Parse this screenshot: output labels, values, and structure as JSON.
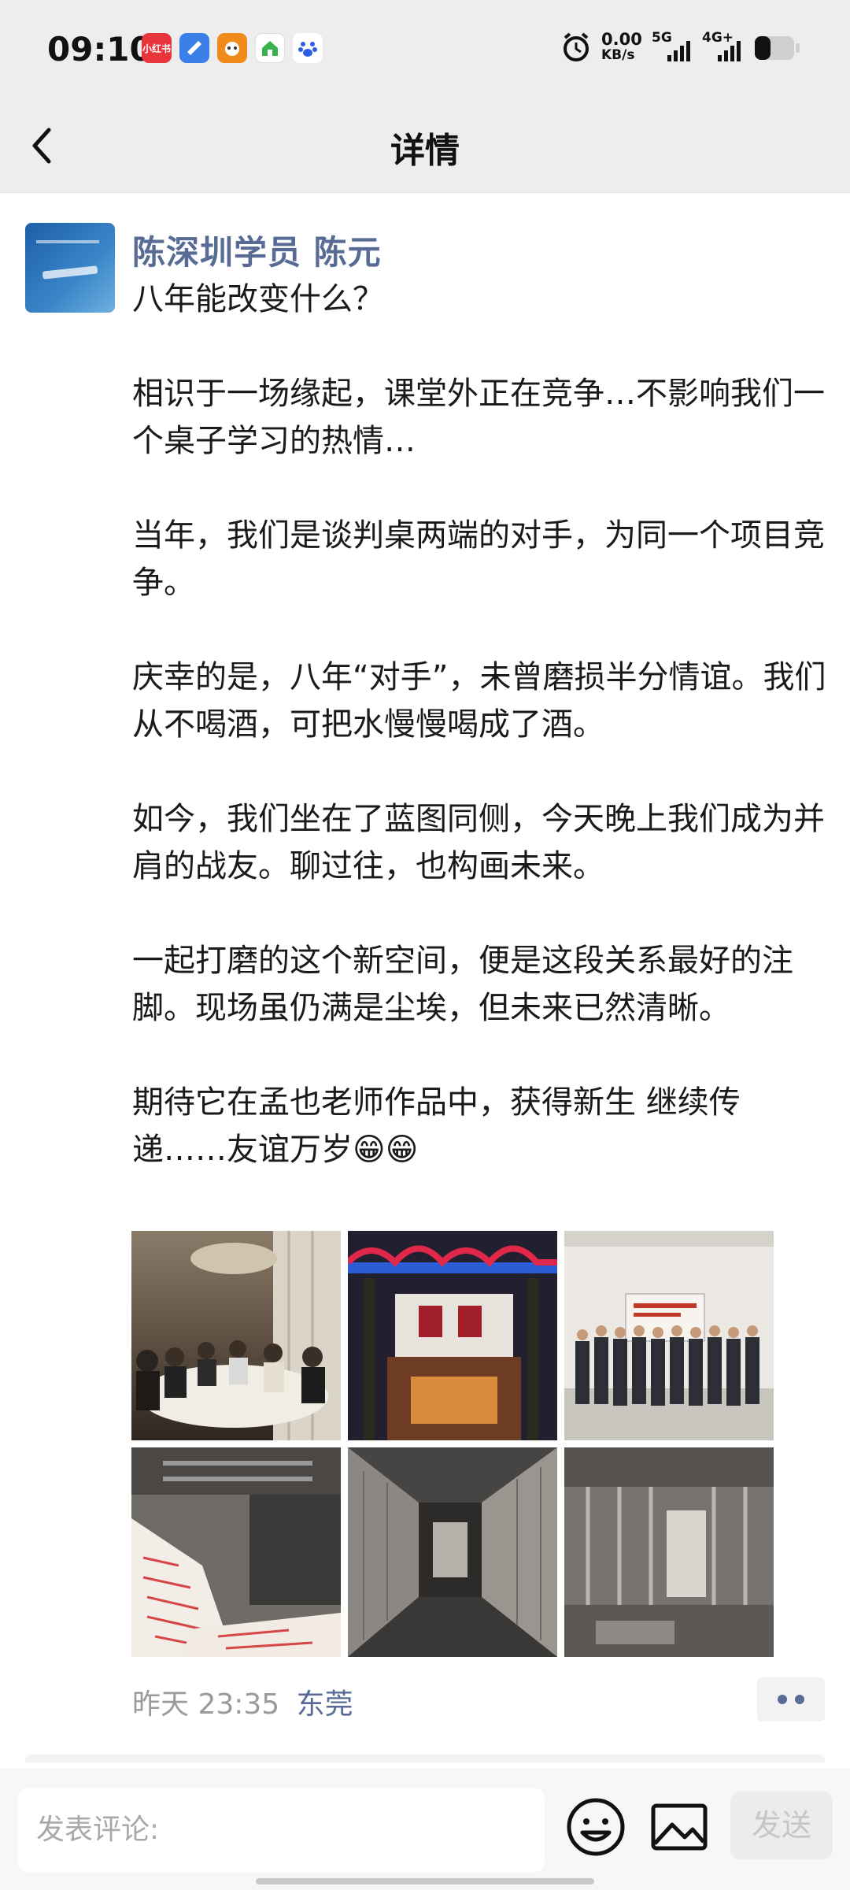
{
  "status_bar": {
    "time": "09:10",
    "net_speed": "0.00",
    "net_unit": "KB/s",
    "signal1": "5G",
    "signal2": "4G+",
    "notif_icons": [
      "xiaohongshu-icon",
      "message-icon",
      "cat-app-icon",
      "home-app-icon",
      "baidu-icon"
    ],
    "notif_colors": [
      "#e8343b",
      "#3b7fe8",
      "#f08a1a",
      "#37b24d",
      "#2e5ee6"
    ]
  },
  "nav": {
    "title": "详情"
  },
  "post": {
    "author": "陈深圳学员 陈元",
    "paragraphs": [
      "八年能改变什么？",
      "",
      "相识于一场缘起，课堂外正在竞争…不影响我们一个桌子学习的热情…",
      "",
      "当年，我们是谈判桌两端的对手，为同一个项目竞争。",
      "",
      "庆幸的是，八年“对手”，未曾磨损半分情谊。我们从不喝酒，可把水慢慢喝成了酒。",
      "",
      "如今，我们坐在了蓝图同侧，今天晚上我们成为并肩的战友。聊过往，也构画未来。",
      "",
      "一起打磨的这个新空间，便是这段关系最好的注脚。现场虽仍满是尘埃，但未来已然清晰。",
      "",
      "期待它在孟也老师作品中，获得新生 继续传递……友谊万岁😁😁"
    ],
    "time": "昨天 23:35",
    "location": "东莞",
    "photos": [
      "dinner-photo",
      "restaurant-sign-photo",
      "group-photo",
      "construction-photo-1",
      "construction-photo-2",
      "construction-photo-3"
    ]
  },
  "bottom_bar": {
    "comment_placeholder": "发表评论:",
    "send_label": "发送"
  }
}
